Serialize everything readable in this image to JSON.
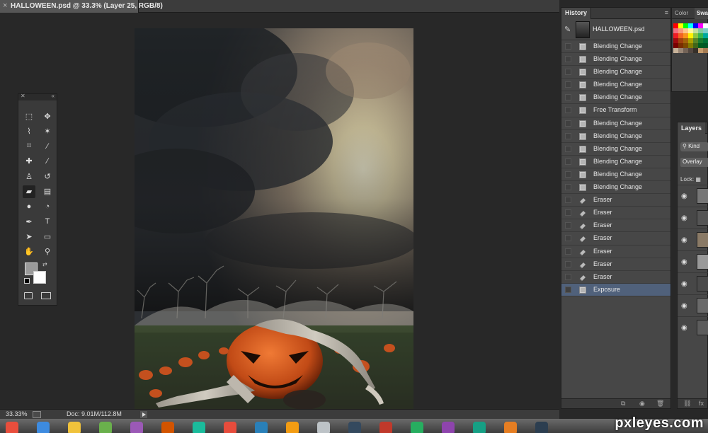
{
  "document": {
    "tab_title": "HALLOWEEN.psd @ 33.3% (Layer 25, RGB/8)",
    "close_glyph": "×"
  },
  "status_bar": {
    "zoom": "33.33%",
    "doc_info": "Doc: 9.01M/112.8M"
  },
  "history": {
    "title": "History",
    "snapshot_name": "HALLOWEEN.psd",
    "states": [
      {
        "label": "Blending Change",
        "icon": "layer-icon"
      },
      {
        "label": "Blending Change",
        "icon": "layer-icon"
      },
      {
        "label": "Blending Change",
        "icon": "layer-icon"
      },
      {
        "label": "Blending Change",
        "icon": "layer-icon"
      },
      {
        "label": "Blending Change",
        "icon": "layer-icon"
      },
      {
        "label": "Free Transform",
        "icon": "layer-icon"
      },
      {
        "label": "Blending Change",
        "icon": "layer-icon"
      },
      {
        "label": "Blending Change",
        "icon": "layer-icon"
      },
      {
        "label": "Blending Change",
        "icon": "layer-icon"
      },
      {
        "label": "Blending Change",
        "icon": "layer-icon"
      },
      {
        "label": "Blending Change",
        "icon": "layer-icon"
      },
      {
        "label": "Blending Change",
        "icon": "layer-icon"
      },
      {
        "label": "Eraser",
        "icon": "eraser-icon"
      },
      {
        "label": "Eraser",
        "icon": "eraser-icon"
      },
      {
        "label": "Eraser",
        "icon": "eraser-icon"
      },
      {
        "label": "Eraser",
        "icon": "eraser-icon"
      },
      {
        "label": "Eraser",
        "icon": "eraser-icon"
      },
      {
        "label": "Eraser",
        "icon": "eraser-icon"
      },
      {
        "label": "Eraser",
        "icon": "eraser-icon"
      },
      {
        "label": "Exposure",
        "icon": "layer-icon",
        "selected": true
      }
    ]
  },
  "color_panel": {
    "tab_color": "Color",
    "tab_swatches": "Swat",
    "swatches": [
      "#ff0000",
      "#ffff00",
      "#00ff00",
      "#00ffff",
      "#0000ff",
      "#ff00ff",
      "#ffffff",
      "#f26d7d",
      "#f7977a",
      "#fdc68a",
      "#fff79a",
      "#c4df9b",
      "#82ca9c",
      "#7bcdc8",
      "#ed1c24",
      "#f26522",
      "#f7941d",
      "#fff200",
      "#8dc63f",
      "#39b54a",
      "#00a99d",
      "#9e0b0f",
      "#a0410d",
      "#a3620a",
      "#aba000",
      "#598527",
      "#197b30",
      "#007236",
      "#790000",
      "#7b2e00",
      "#7d4900",
      "#827b00",
      "#406618",
      "#005e20",
      "#005826",
      "#c7b299",
      "#998675",
      "#736357",
      "#534741",
      "#37302a",
      "#c69c6d",
      "#a67c52"
    ]
  },
  "layers": {
    "title": "Layers",
    "kind_label": "Kind",
    "blend_mode": "Overlay",
    "lock_label": "Lock:",
    "thumbs": [
      "#777",
      "#555",
      "#8a7a66",
      "#999",
      "#4a4a4a",
      "#6a6a6a",
      "#5c5c5c"
    ]
  },
  "dock": {
    "watermark": "pxleyes.com",
    "colors": [
      "#e94e3c",
      "#3d8be0",
      "#f0c23b",
      "#6ab04c",
      "#9b59b6",
      "#d35400",
      "#1abc9c",
      "#e74c3c",
      "#2980b9",
      "#f39c12",
      "#bdc3c7",
      "#34495e",
      "#c0392b",
      "#27ae60",
      "#8e44ad",
      "#16a085",
      "#e67e22",
      "#2c3e50"
    ]
  },
  "tools": [
    {
      "name": "marquee-tool",
      "glyph": "⬚"
    },
    {
      "name": "move-tool",
      "glyph": "✥"
    },
    {
      "name": "lasso-tool",
      "glyph": "⌇"
    },
    {
      "name": "magic-wand-tool",
      "glyph": "✶"
    },
    {
      "name": "crop-tool",
      "glyph": "⌗"
    },
    {
      "name": "eyedropper-tool",
      "glyph": "⁄"
    },
    {
      "name": "healing-brush-tool",
      "glyph": "✚"
    },
    {
      "name": "brush-tool",
      "glyph": "∕"
    },
    {
      "name": "clone-stamp-tool",
      "glyph": "♙"
    },
    {
      "name": "history-brush-tool",
      "glyph": "↺"
    },
    {
      "name": "eraser-tool",
      "glyph": "▰"
    },
    {
      "name": "gradient-tool",
      "glyph": "▤"
    },
    {
      "name": "blur-tool",
      "glyph": "●"
    },
    {
      "name": "dodge-tool",
      "glyph": "◔"
    },
    {
      "name": "pen-tool",
      "glyph": "✒"
    },
    {
      "name": "type-tool",
      "glyph": "T"
    },
    {
      "name": "path-selection-tool",
      "glyph": "➤"
    },
    {
      "name": "rectangle-tool",
      "glyph": "▭"
    },
    {
      "name": "hand-tool",
      "glyph": "✋"
    },
    {
      "name": "zoom-tool",
      "glyph": "⚲"
    }
  ]
}
